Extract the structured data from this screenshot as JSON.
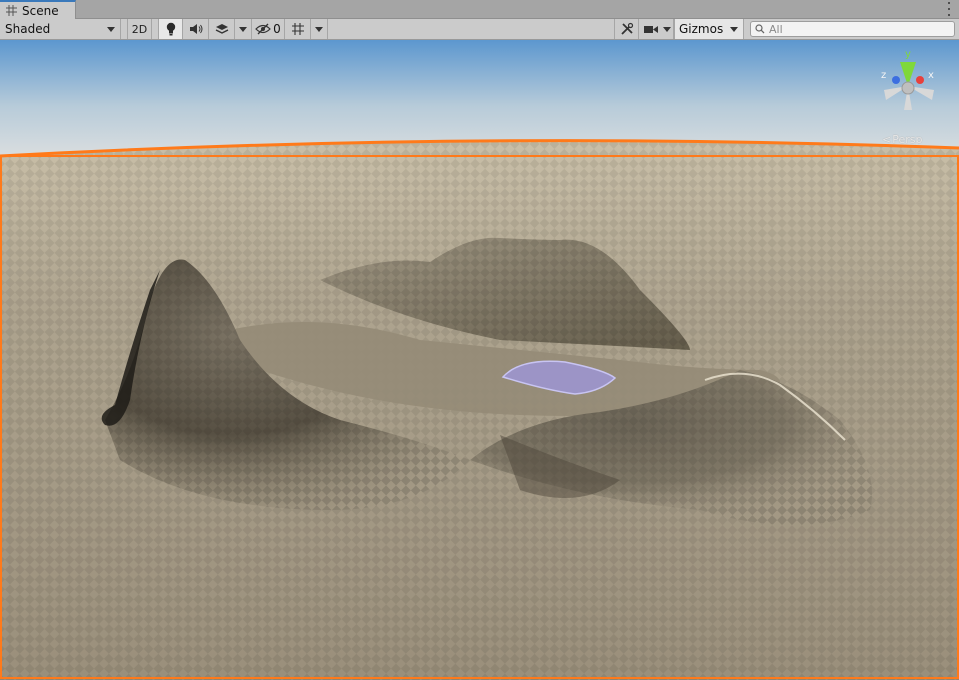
{
  "window": {
    "tab_label": "Scene",
    "tab_icon": "grid-icon"
  },
  "toolbar": {
    "shading_mode": "Shaded",
    "toggle_2d": "2D",
    "hidden_count": "0",
    "gizmos_label": "Gizmos",
    "search_placeholder": "All"
  },
  "viewport": {
    "projection_label": "Persp",
    "axis_labels": {
      "x": "x",
      "y": "y",
      "z": "z"
    },
    "colors": {
      "selection_outline": "#ff7a1a",
      "sky_top": "#5c97cf",
      "sky_horizon": "#dcdfe0",
      "ground": "#a59a86",
      "water": "#9d97e0",
      "axis_x": "#e8403c",
      "axis_y": "#7fd83b",
      "axis_z": "#3d6fe0"
    }
  }
}
